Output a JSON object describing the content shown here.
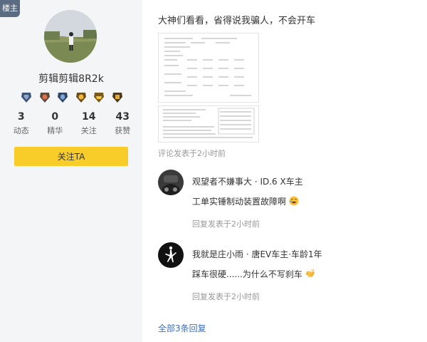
{
  "sidebar": {
    "owner_badge": "楼主",
    "username": "剪辑剪辑8R2k",
    "medals": [
      "medal-1-icon",
      "medal-2-icon",
      "medal-3-icon",
      "medal-4-icon",
      "medal-5-icon",
      "medal-6-icon"
    ],
    "stats": [
      {
        "num": "3",
        "label": "动态"
      },
      {
        "num": "0",
        "label": "精华"
      },
      {
        "num": "14",
        "label": "关注"
      },
      {
        "num": "43",
        "label": "获赞"
      }
    ],
    "follow_label": "关注TA"
  },
  "post": {
    "text": "大神们看看，省得说我骗人，不会开车",
    "meta": "评论发表于2小时前"
  },
  "replies": [
    {
      "author": "观望者不嫌事大 · ID.6 X车主",
      "text": "工单实锤制动装置故障啊",
      "emoji": "laughing-emoji-icon",
      "meta": "回复发表于2小时前"
    },
    {
      "author": "我就是庄小雨 · 唐EV车主·车龄1年",
      "text": "踩车很硬......为什么不写刹车",
      "emoji": "clapping-emoji-icon",
      "meta": "回复发表于2小时前"
    }
  ],
  "all_replies_label": "全部3条回复"
}
